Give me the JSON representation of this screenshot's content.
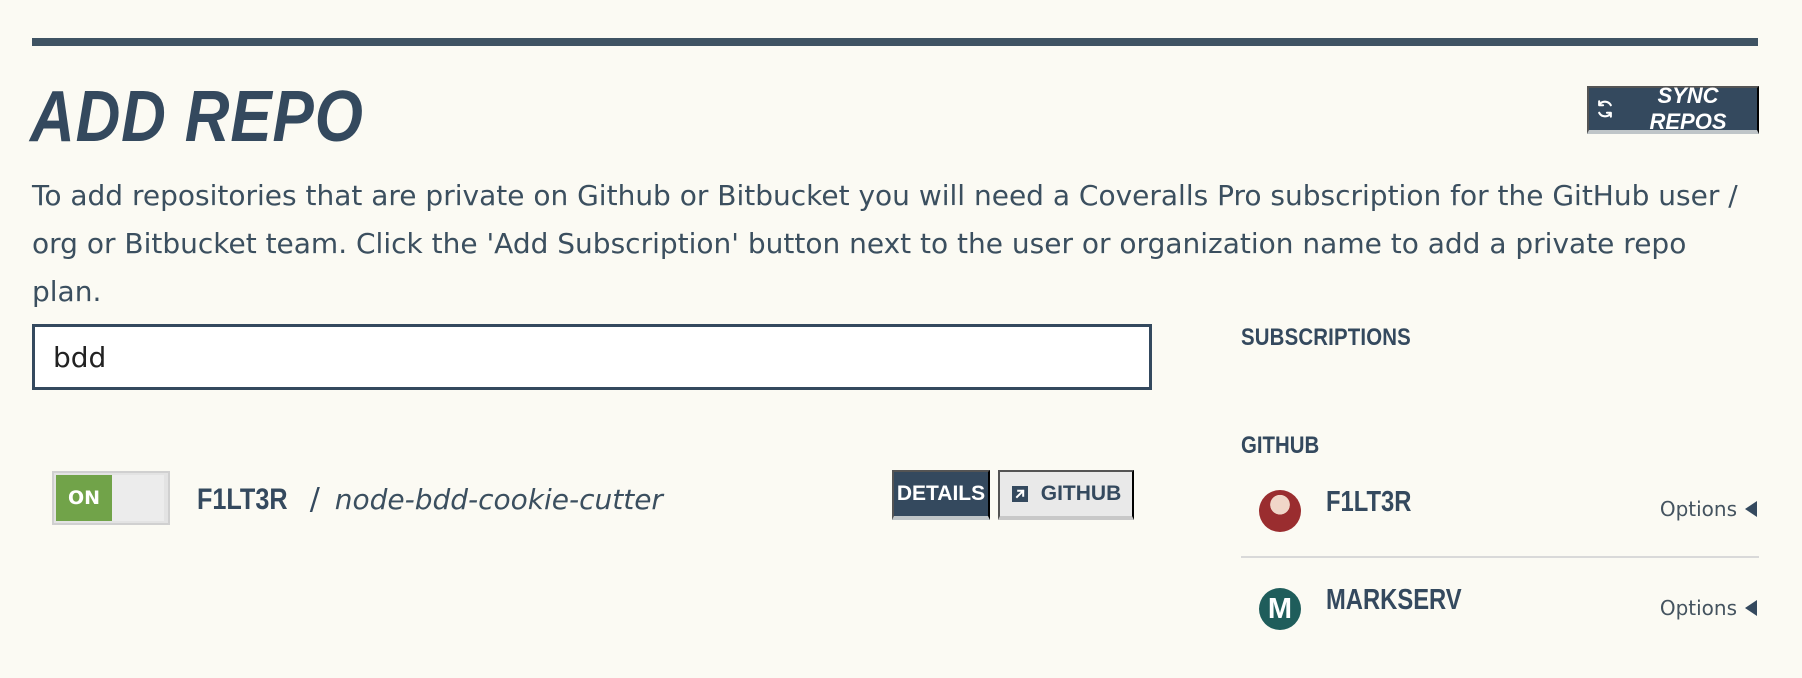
{
  "page": {
    "title": "ADD REPO",
    "sync_button_label": "SYNC REPOS",
    "intro": "To add repositories that are private on Github or Bitbucket you will need a Coveralls Pro subscription for the GitHub user / org or Bitbucket team. Click the 'Add Subscription' button next to the user or organization name to add a private repo plan."
  },
  "search": {
    "value": "bdd",
    "placeholder": ""
  },
  "repository": {
    "toggle_state": "ON",
    "owner": "F1LT3R",
    "separator": "/",
    "name": "node-bdd-cookie-cutter",
    "details_label": "DETAILS",
    "github_label": "GITHUB"
  },
  "subscriptions": {
    "heading": "SUBSCRIPTIONS",
    "provider": "GITHUB",
    "items": [
      {
        "name": "F1LT3R",
        "options_label": "Options",
        "avatar_icon": "user-avatar"
      },
      {
        "name": "MARKSERV",
        "options_label": "Options",
        "avatar_icon": "markserv-logo",
        "avatar_letter": "M"
      }
    ]
  },
  "colors": {
    "background": "#fbfaf3",
    "primary": "#34495e",
    "toggle_on": "#71a349",
    "secondary_button": "#e9e9e9"
  }
}
